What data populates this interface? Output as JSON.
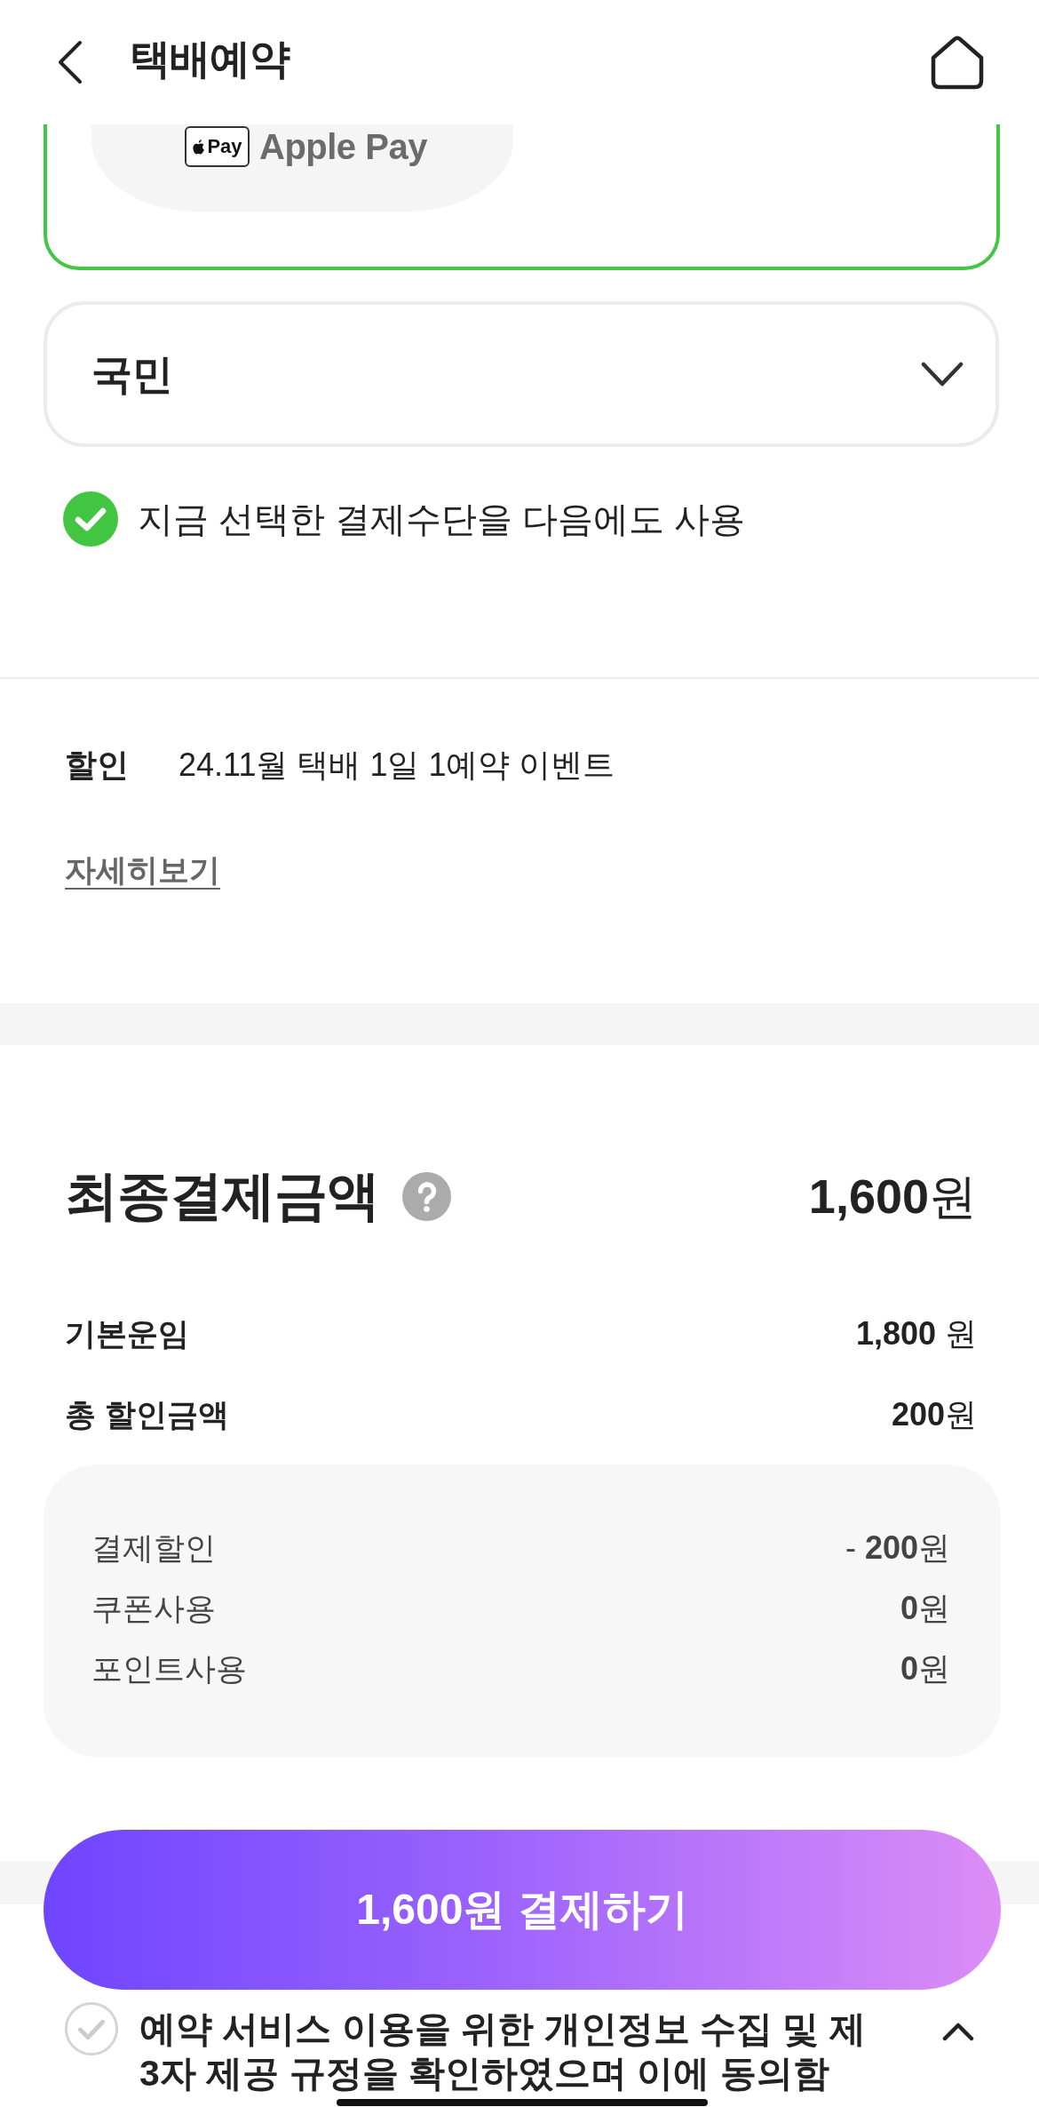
{
  "header": {
    "title": "택배예약"
  },
  "payment_option": {
    "logo_text": "Pay",
    "label": "Apple Pay",
    "selected": true
  },
  "bank_select": {
    "value": "국민"
  },
  "save_method": {
    "label": "지금 선택한 결제수단을 다음에도 사용",
    "checked": true
  },
  "discount": {
    "label": "할인",
    "value": "24.11월 택배 1일 1예약 이벤트",
    "link": "자세히보기"
  },
  "total": {
    "label": "최종결제금액",
    "amount": "**1,600**원"
  },
  "fees": [
    {
      "label": "기본운임",
      "value": "**1,800** 원"
    },
    {
      "label": "총 할인금액",
      "value": "**200**원"
    }
  ],
  "breakdown": [
    {
      "label": "결제할인",
      "value": "- **200**원"
    },
    {
      "label": "쿠폰사용",
      "value": "**0**원"
    },
    {
      "label": "포인트사용",
      "value": "**0**원"
    }
  ],
  "pay_button": {
    "label": "1,600원 결제하기"
  },
  "agreement": {
    "text": "예약 서비스 이용을 위한 개인정보 수집 및 제3자 제공 규정을 확인하였으며 이에 동의함",
    "checked": false,
    "expanded": true
  }
}
